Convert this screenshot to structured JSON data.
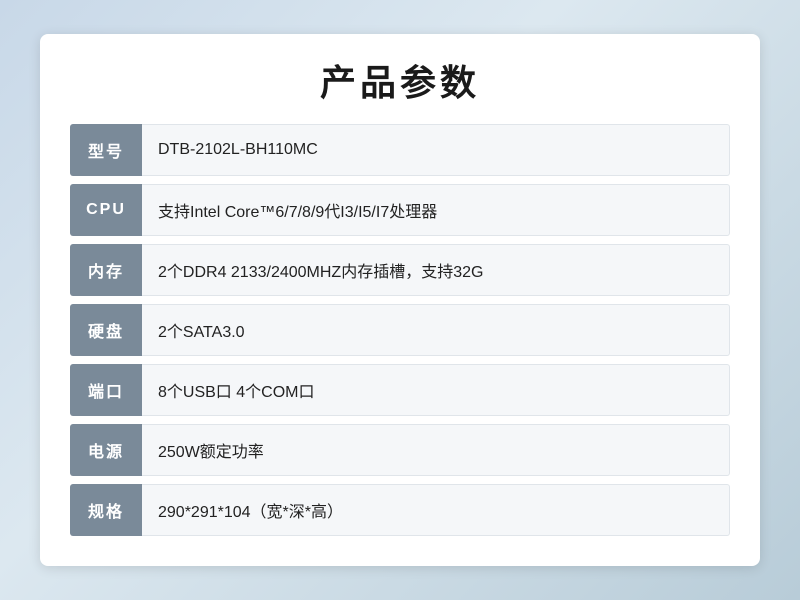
{
  "page": {
    "title": "产品参数",
    "rows": [
      {
        "label": "型号",
        "value": "DTB-2102L-BH110MC"
      },
      {
        "label": "CPU",
        "value": "支持Intel Core™6/7/8/9代I3/I5/I7处理器"
      },
      {
        "label": "内存",
        "value": "2个DDR4 2133/2400MHZ内存插槽，支持32G"
      },
      {
        "label": "硬盘",
        "value": "2个SATA3.0"
      },
      {
        "label": "端口",
        "value": "8个USB口 4个COM口"
      },
      {
        "label": "电源",
        "value": "250W额定功率"
      },
      {
        "label": "规格",
        "value": "290*291*104（宽*深*高）"
      }
    ]
  }
}
